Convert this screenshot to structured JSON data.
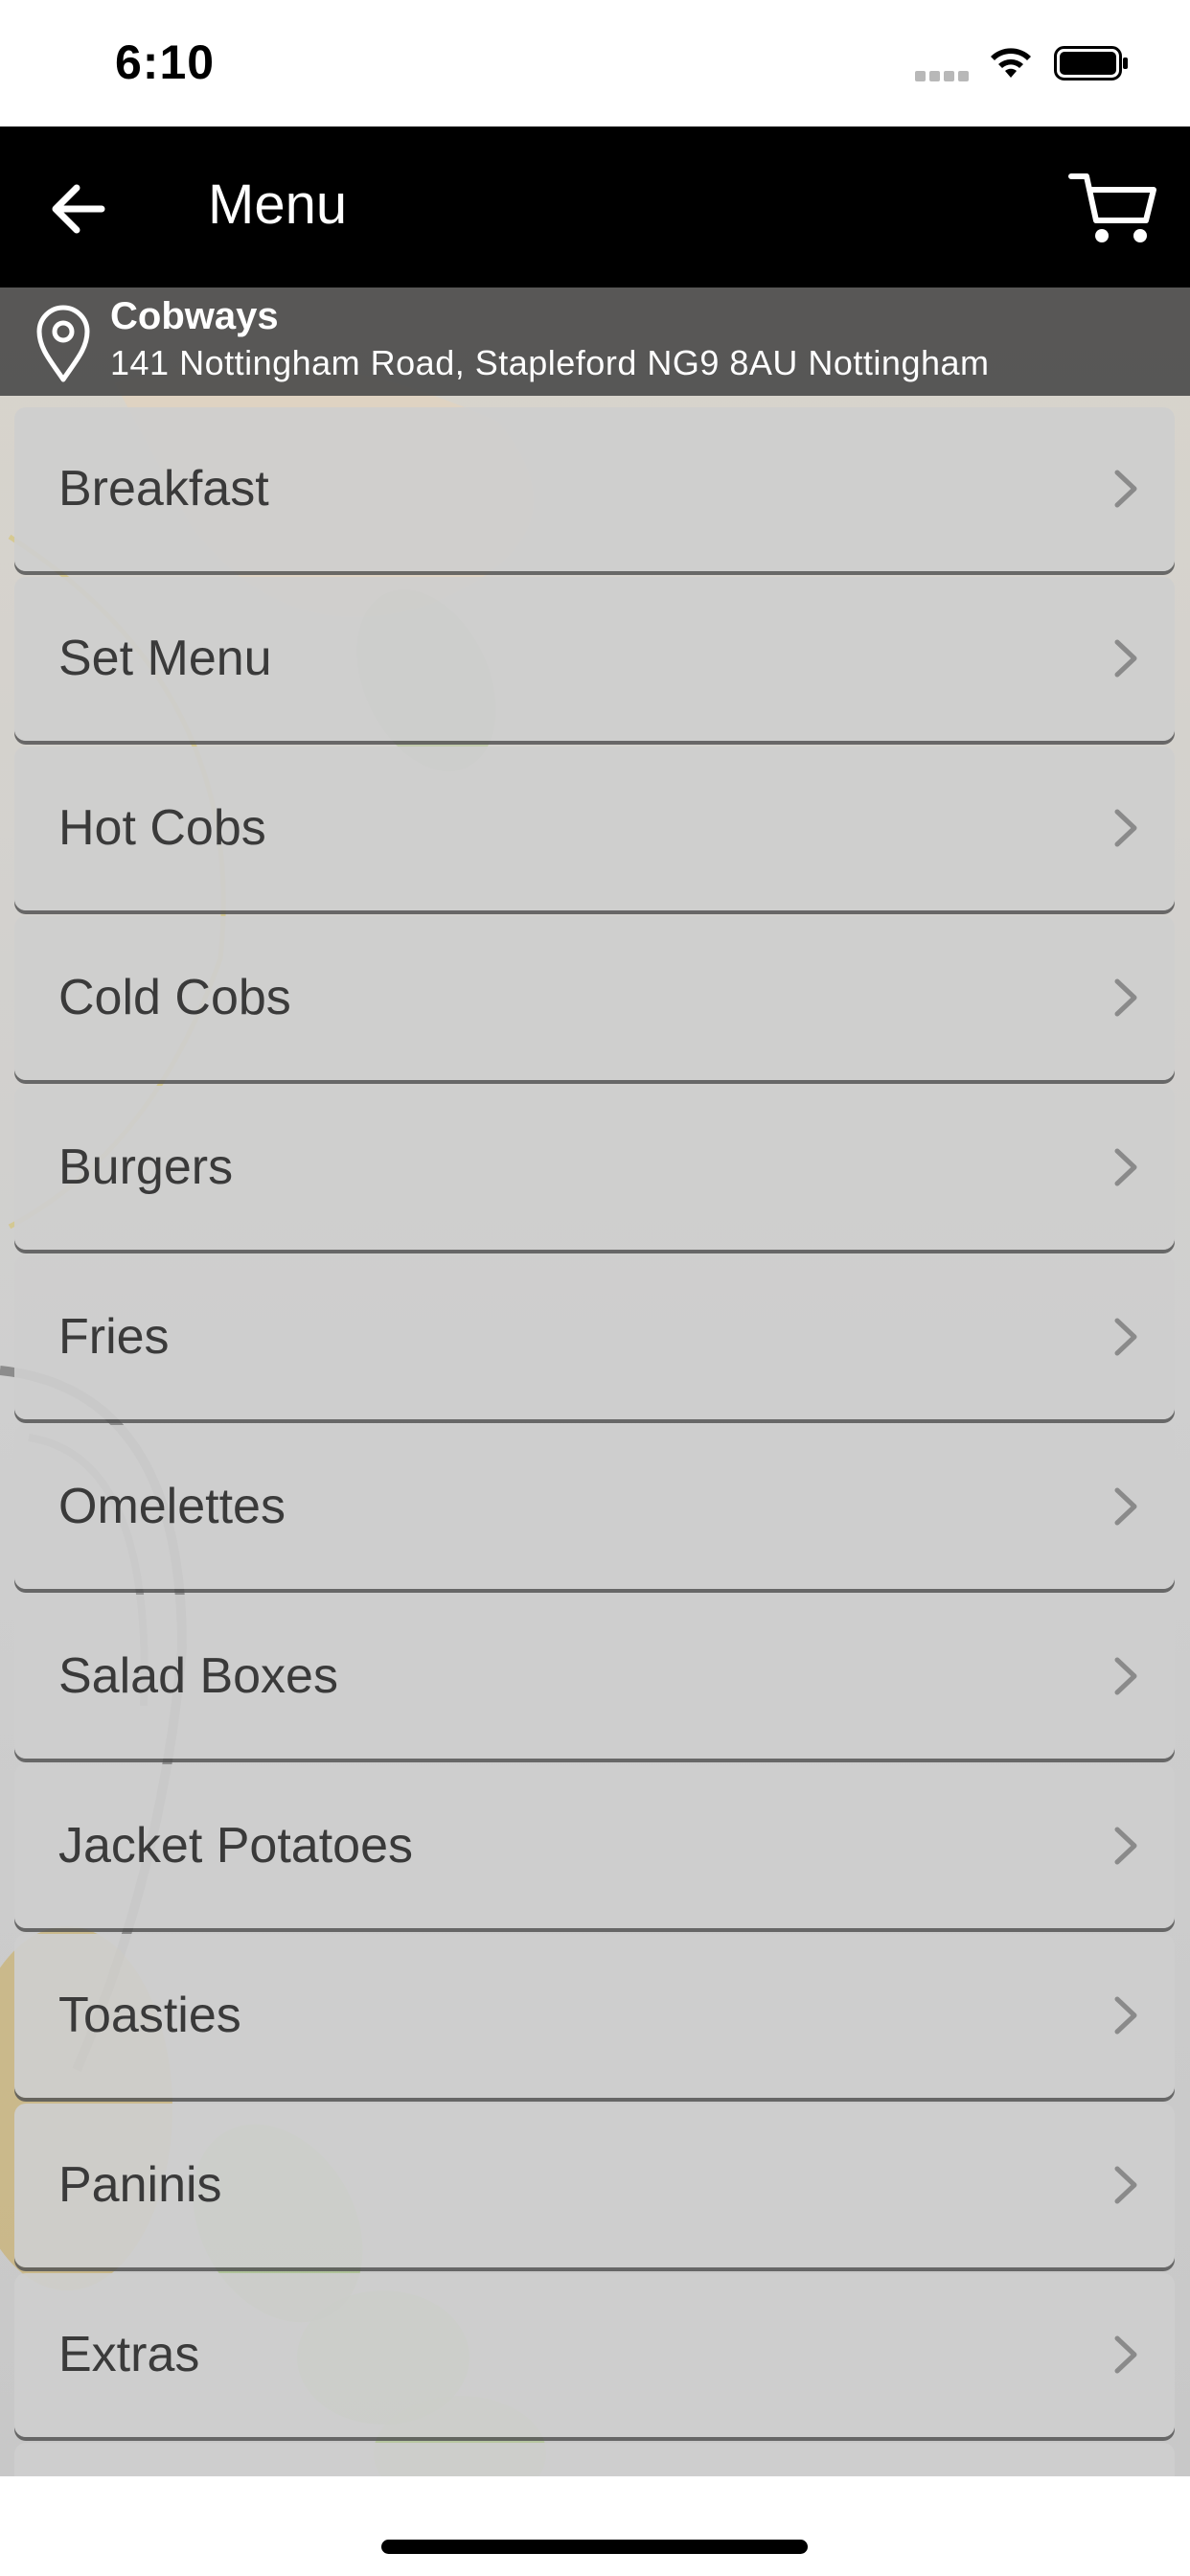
{
  "status_bar": {
    "time": "6:10",
    "icons": [
      "signal-dots-icon",
      "wifi-icon",
      "battery-icon"
    ]
  },
  "nav": {
    "title": "Menu",
    "back_icon": "arrow-left-icon",
    "cart_icon": "cart-icon",
    "background_color": "#000000",
    "title_color": "#ffffff"
  },
  "location": {
    "name": "Cobways",
    "address": "141 Nottingham Road, Stapleford NG9 8AU Nottingham",
    "icon": "location-pin-icon"
  },
  "menu": {
    "items": [
      {
        "label": "Breakfast"
      },
      {
        "label": "Set Menu"
      },
      {
        "label": "Hot Cobs"
      },
      {
        "label": "Cold Cobs"
      },
      {
        "label": "Burgers"
      },
      {
        "label": "Fries"
      },
      {
        "label": "Omelettes"
      },
      {
        "label": "Salad Boxes"
      },
      {
        "label": "Jacket Potatoes"
      },
      {
        "label": "Toasties"
      },
      {
        "label": "Paninis"
      },
      {
        "label": "Extras"
      },
      {
        "label": ""
      }
    ],
    "item_icon": "chevron-right-icon"
  }
}
